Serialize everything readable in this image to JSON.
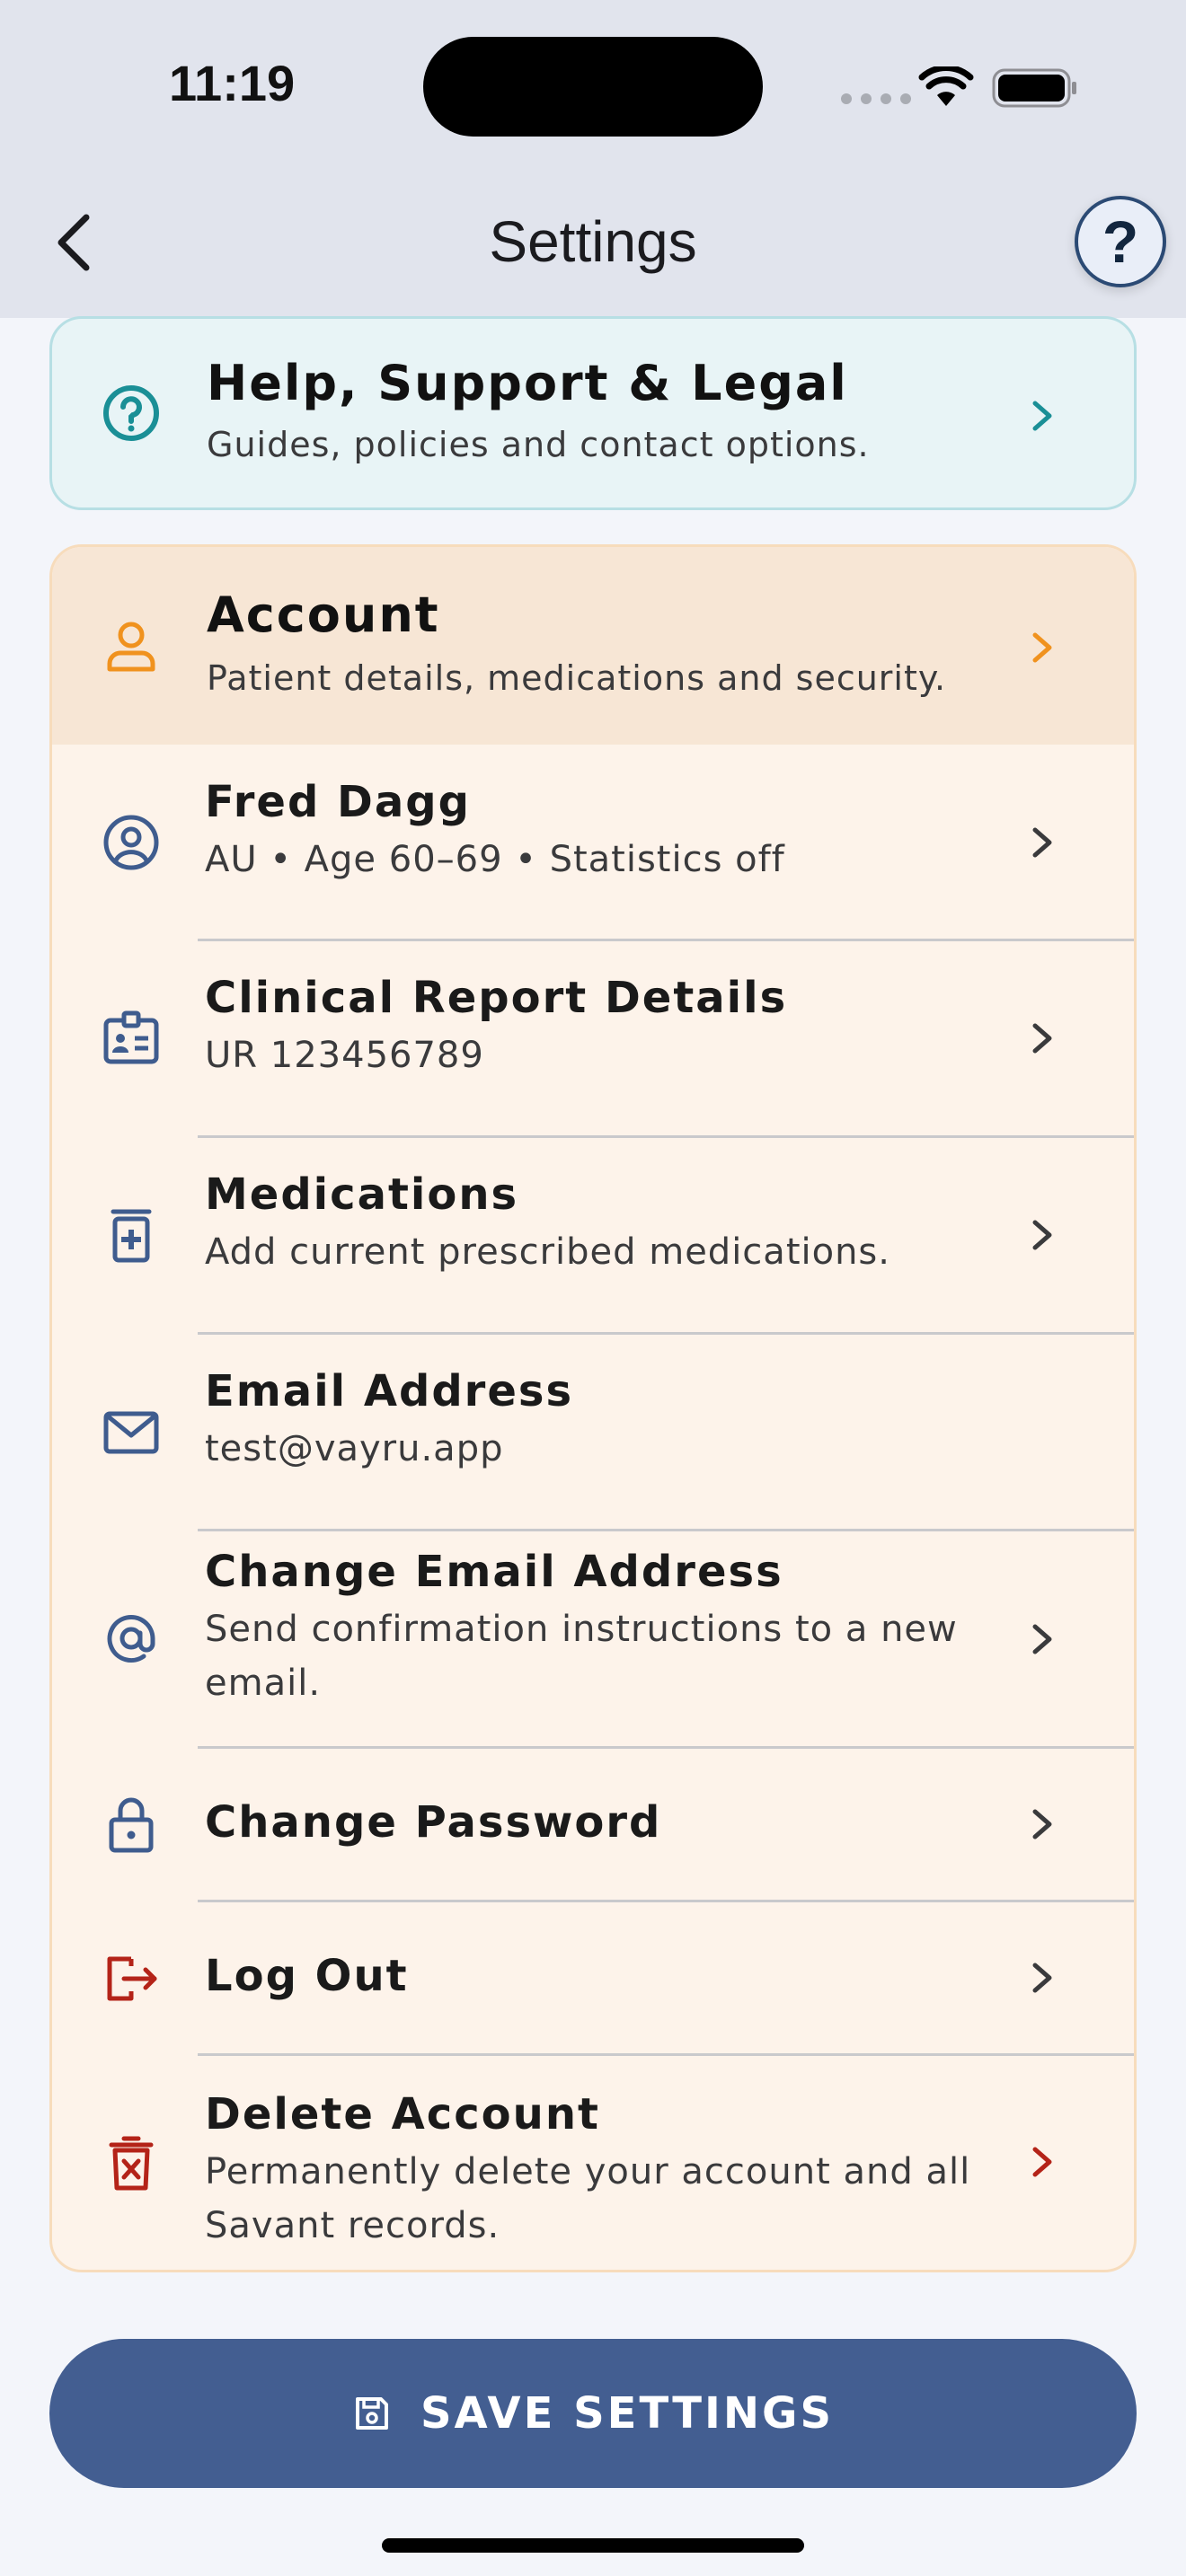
{
  "status_bar": {
    "time": "11:19"
  },
  "header": {
    "title": "Settings",
    "help_label": "?"
  },
  "help_card": {
    "title": "Help, Support & Legal",
    "subtitle": "Guides, policies and contact options."
  },
  "account": {
    "title": "Account",
    "subtitle": "Patient details, medications and security.",
    "rows": [
      {
        "title": "Fred Dagg",
        "subtitle": "AU • Age 60–69 • Statistics off",
        "icon": "user-circle-icon"
      },
      {
        "title": "Clinical Report Details",
        "subtitle": "UR 123456789",
        "icon": "id-badge-icon"
      },
      {
        "title": "Medications",
        "subtitle": "Add current prescribed medications.",
        "icon": "medication-bottle-icon"
      },
      {
        "title": "Email Address",
        "subtitle": "test@vayru.app",
        "icon": "envelope-icon"
      },
      {
        "title": "Change Email Address",
        "subtitle": "Send confirmation instructions to a new email.",
        "icon": "at-sign-icon"
      },
      {
        "title": "Change Password",
        "subtitle": "",
        "icon": "lock-icon"
      },
      {
        "title": "Log Out",
        "subtitle": "",
        "icon": "logout-icon"
      },
      {
        "title": "Delete Account",
        "subtitle": "Permanently delete your account and all Savant records.",
        "icon": "delete-bin-icon"
      }
    ]
  },
  "save_button": {
    "label": "SAVE SETTINGS",
    "icon": "floppy-disk-icon"
  },
  "colors": {
    "help_accent": "#1a8f96",
    "account_accent": "#f0921e",
    "icon_blue": "#3f5c8e",
    "danger": "#b42318",
    "button": "#435e91"
  }
}
